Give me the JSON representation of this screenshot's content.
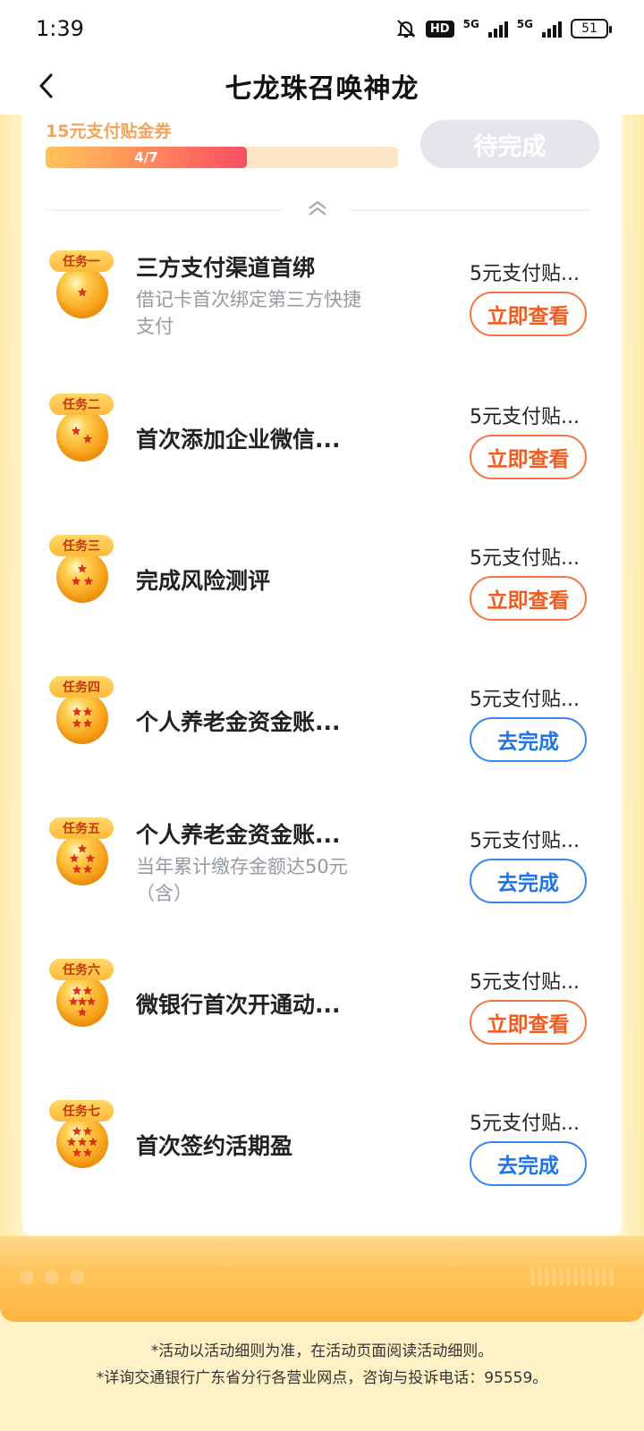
{
  "status_bar": {
    "time": "1:39",
    "hd": "HD",
    "net1": "5G",
    "net2": "5G",
    "battery": "51"
  },
  "nav": {
    "title": "七龙珠召唤神龙"
  },
  "progress": {
    "coupon_label": "15元支付贴金券",
    "text": "4/7",
    "fraction": 0.571,
    "button": "待完成"
  },
  "tasks": [
    {
      "badge": "任务一",
      "title": "三方支付渠道首绑",
      "desc": "借记卡首次绑定第三方快捷支付",
      "reward": "5元支付贴...",
      "button": "立即查看",
      "style": "orange",
      "stars": 1
    },
    {
      "badge": "任务二",
      "title": "首次添加企业微信...",
      "desc": "",
      "reward": "5元支付贴...",
      "button": "立即查看",
      "style": "orange",
      "stars": 2
    },
    {
      "badge": "任务三",
      "title": "完成风险测评",
      "desc": "",
      "reward": "5元支付贴...",
      "button": "立即查看",
      "style": "orange",
      "stars": 3
    },
    {
      "badge": "任务四",
      "title": "个人养老金资金账...",
      "desc": "",
      "reward": "5元支付贴...",
      "button": "去完成",
      "style": "blue",
      "stars": 4
    },
    {
      "badge": "任务五",
      "title": "个人养老金资金账...",
      "desc": "当年累计缴存金额达50元（含）",
      "reward": "5元支付贴...",
      "button": "去完成",
      "style": "blue",
      "stars": 5
    },
    {
      "badge": "任务六",
      "title": "微银行首次开通动...",
      "desc": "",
      "reward": "5元支付贴...",
      "button": "立即查看",
      "style": "orange",
      "stars": 6
    },
    {
      "badge": "任务七",
      "title": "首次签约活期盈",
      "desc": "",
      "reward": "5元支付贴...",
      "button": "去完成",
      "style": "blue",
      "stars": 7
    }
  ],
  "footer": {
    "line1": "*活动以活动细则为准，在活动页面阅读活动细则。",
    "line2": "*详询交通银行广东省分行各营业网点，咨询与投诉电话：95559。"
  },
  "colors": {
    "accent_orange": "#f05a1e",
    "accent_blue": "#1f73e6",
    "background": "#fff2c6"
  }
}
